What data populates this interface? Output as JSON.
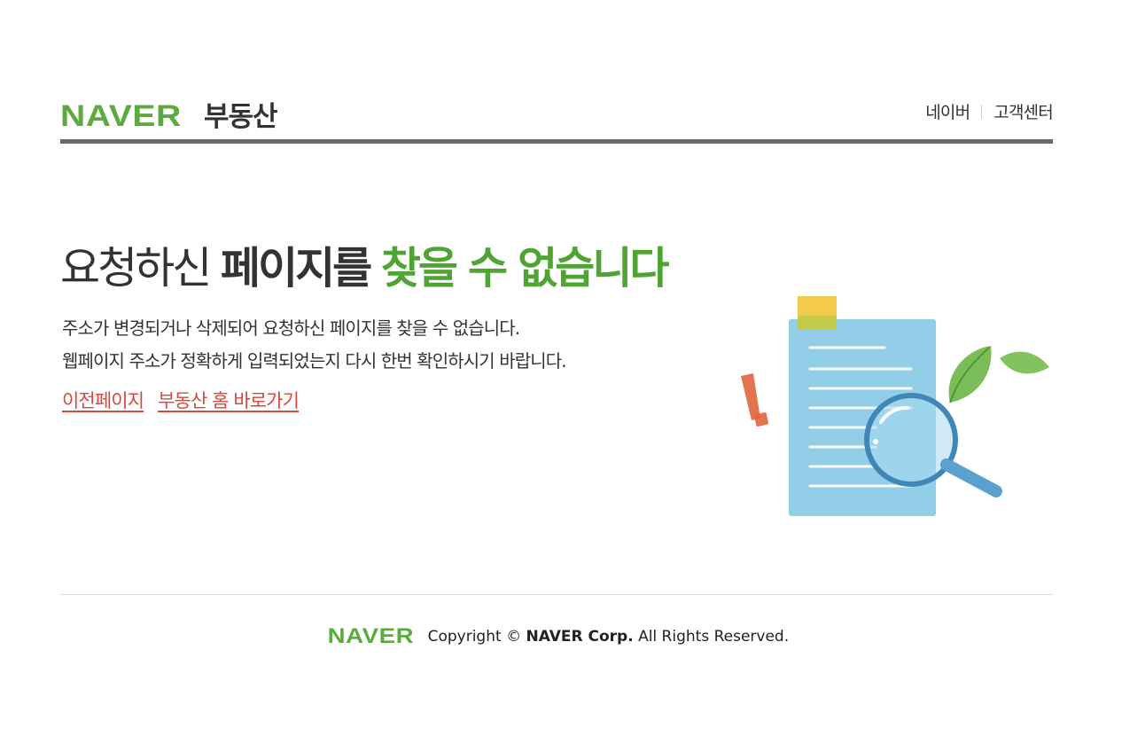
{
  "header": {
    "logo_brand": "NAVER",
    "logo_service": "부동산",
    "nav": [
      {
        "label": "네이버"
      },
      {
        "label": "고객센터"
      }
    ]
  },
  "content": {
    "title_part1": "요청하신",
    "title_part2": "페이지를",
    "title_accent": "찾을 수 없습니다",
    "desc_line1": "주소가 변경되거나 삭제되어 요청하신 페이지를 찾을 수 없습니다.",
    "desc_line2": "웹페이지 주소가 정확하게 입력되었는지 다시 한번 확인하시기 바랍니다.",
    "link_prev": "이전페이지",
    "link_home": "부동산 홈 바로가기"
  },
  "footer": {
    "logo": "NAVER",
    "copyright_prefix": "Copyright ©",
    "corp": "NAVER Corp.",
    "rights": "All Rights Reserved."
  },
  "colors": {
    "brand_green": "#5cab3f",
    "accent_green": "#4fa434",
    "link_red": "#d9483d",
    "header_rule": "#6a6a6a"
  },
  "icons": [
    "document-magnifier-illustration"
  ]
}
